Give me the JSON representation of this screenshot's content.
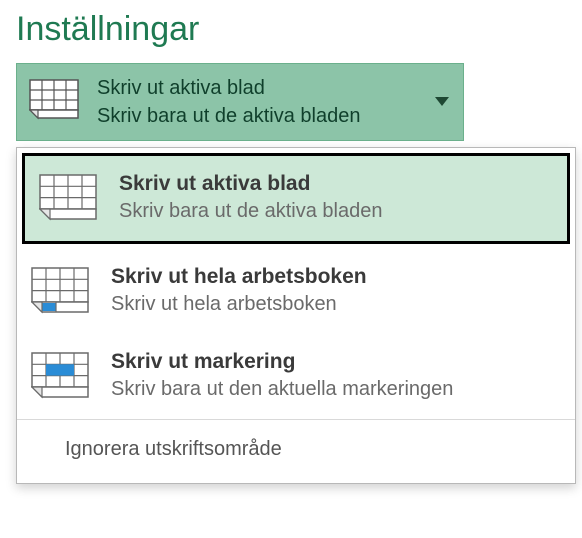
{
  "section_title": "Inställningar",
  "selected": {
    "title": "Skriv ut aktiva blad",
    "description": "Skriv bara ut de aktiva bladen"
  },
  "options": [
    {
      "title": "Skriv ut aktiva blad",
      "description": "Skriv bara ut de aktiva bladen"
    },
    {
      "title": "Skriv ut hela arbetsboken",
      "description": "Skriv ut hela arbetsboken"
    },
    {
      "title": "Skriv ut markering",
      "description": "Skriv bara ut den aktuella markeringen"
    }
  ],
  "toggle_label": "Ignorera utskriftsområde"
}
